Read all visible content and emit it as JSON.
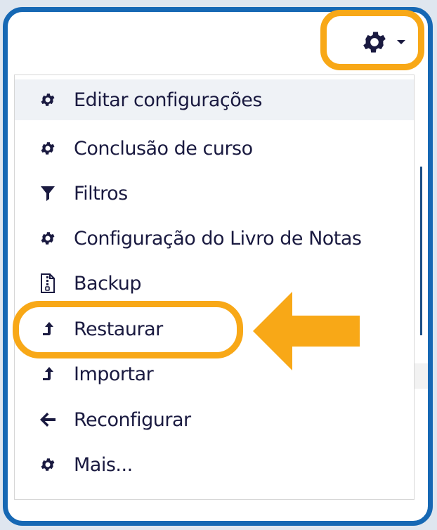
{
  "colors": {
    "frame_border": "#1668b4",
    "highlight": "#f8a817",
    "icon": "#1a1a40",
    "text": "#1a1a40",
    "active_row": "#eff2f6"
  },
  "header": {
    "settings_button": {
      "icon": "gear-icon",
      "dropdown": "caret-down-icon"
    }
  },
  "menu": {
    "items": [
      {
        "label": "Editar configurações",
        "icon": "gear-icon",
        "active": true
      },
      {
        "label": "Conclusão de curso",
        "icon": "gear-icon",
        "active": false
      },
      {
        "label": "Filtros",
        "icon": "filter-icon",
        "active": false
      },
      {
        "label": "Configuração do Livro de Notas",
        "icon": "gear-icon",
        "active": false
      },
      {
        "label": "Backup",
        "icon": "file-archive-icon",
        "active": false
      },
      {
        "label": "Restaurar",
        "icon": "level-up-icon",
        "active": false,
        "highlighted": true
      },
      {
        "label": "Importar",
        "icon": "level-up-icon",
        "active": false
      },
      {
        "label": "Reconfigurar",
        "icon": "arrow-left-icon",
        "active": false
      },
      {
        "label": "Mais...",
        "icon": "gear-icon",
        "active": false
      }
    ]
  },
  "annotations": {
    "highlighted_item": "Restaurar",
    "pointer": "arrow-left-icon"
  }
}
